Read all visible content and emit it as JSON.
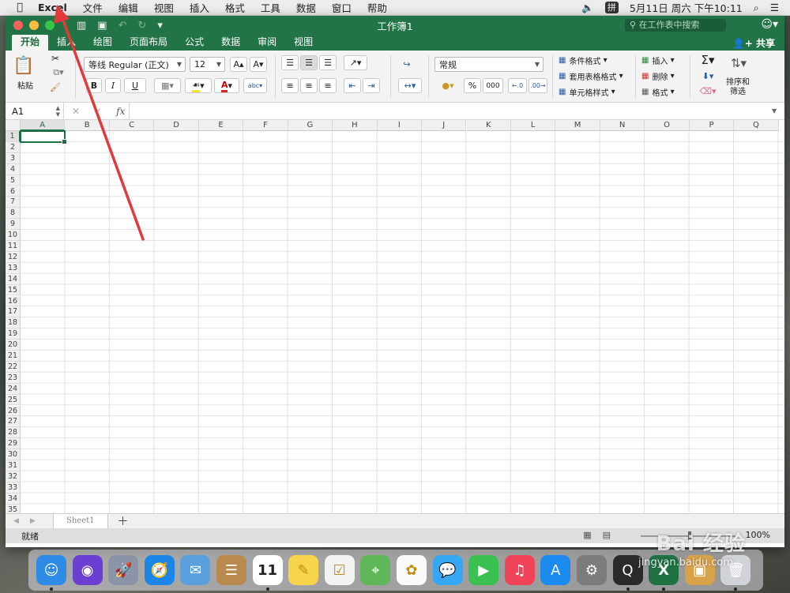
{
  "menubar": {
    "apple": "",
    "items": [
      "Excel",
      "文件",
      "编辑",
      "视图",
      "插入",
      "格式",
      "工具",
      "数据",
      "窗口",
      "帮助"
    ],
    "volume": "🔈",
    "ime": "拼",
    "datetime": "5月11日 周六 下午10:11",
    "search_glyph": "⌕",
    "list_glyph": "☰"
  },
  "window": {
    "title": "工作簿1",
    "search_placeholder": "在工作表中搜索",
    "share_label": "共享",
    "quick_access": {
      "sidebar": "▥",
      "save": "▣",
      "undo": "↶",
      "redo": "↻",
      "more": "▾"
    }
  },
  "tabs": [
    "开始",
    "插入",
    "绘图",
    "页面布局",
    "公式",
    "数据",
    "审阅",
    "视图"
  ],
  "ribbon": {
    "paste_label": "粘贴",
    "font_name": "等线 Regular (正文)",
    "font_size": "12",
    "bold": "B",
    "italic": "I",
    "underline": "U",
    "number_format": "常规",
    "percent": "%",
    "thousands": "000",
    "cond_format": "条件格式",
    "table_format": "套用表格格式",
    "cell_style": "单元格样式",
    "insert": "插入",
    "delete": "删除",
    "format": "格式",
    "sort_filter": [
      "排序和",
      "筛选"
    ],
    "grow_font": "A▴",
    "shrink_font": "A▾",
    "dec_inc": ".0\n.00"
  },
  "formula_bar": {
    "name_box": "A1",
    "fx": "fx",
    "value": ""
  },
  "grid": {
    "columns": [
      "A",
      "B",
      "C",
      "D",
      "E",
      "F",
      "G",
      "H",
      "I",
      "J",
      "K",
      "L",
      "M",
      "N",
      "O",
      "P",
      "Q"
    ],
    "row_count": 35,
    "selected_cell": "A1"
  },
  "sheets": [
    "Sheet1"
  ],
  "status": {
    "ready": "就绪",
    "zoom": "100%"
  },
  "watermark": {
    "text": "Bai  经验",
    "url": "jingyan.baidu.com"
  },
  "dock": [
    {
      "name": "finder",
      "color": "#2d8be6"
    },
    {
      "name": "siri",
      "color": "#6b3fd1"
    },
    {
      "name": "launchpad",
      "color": "#8a94a6"
    },
    {
      "name": "safari",
      "color": "#1c86e8"
    },
    {
      "name": "mail",
      "color": "#5aa0dc"
    },
    {
      "name": "contacts",
      "color": "#b98a4e"
    },
    {
      "name": "calendar",
      "color": "#ffffff",
      "label": "11"
    },
    {
      "name": "notes",
      "color": "#f6d44c"
    },
    {
      "name": "reminders",
      "color": "#f3f3f3"
    },
    {
      "name": "maps",
      "color": "#5fb75a"
    },
    {
      "name": "photos",
      "color": "#fafafa"
    },
    {
      "name": "messages",
      "color": "#35a7f3"
    },
    {
      "name": "facetime",
      "color": "#3ac152"
    },
    {
      "name": "music",
      "color": "#f0435a"
    },
    {
      "name": "app-store",
      "color": "#1c8bf0"
    },
    {
      "name": "system-preferences",
      "color": "#7c7c7c"
    },
    {
      "name": "quicktime",
      "color": "#2a2a2a"
    },
    {
      "name": "excel",
      "color": "#1f7244",
      "label": "X"
    },
    {
      "name": "archive",
      "color": "#d8a24a"
    },
    {
      "name": "trash",
      "color": "#d0d4d8"
    }
  ]
}
